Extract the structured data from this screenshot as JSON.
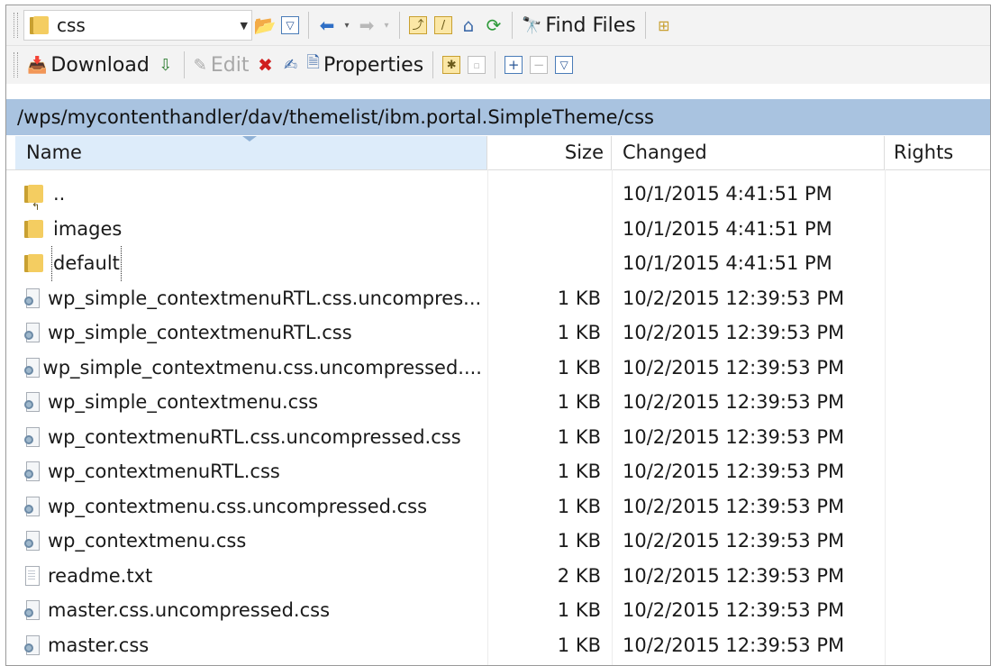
{
  "toolbar1": {
    "path_combo_value": "css",
    "find_files_label": "Find Files"
  },
  "toolbar2": {
    "download_label": "Download",
    "edit_label": "Edit",
    "properties_label": "Properties"
  },
  "path": "/wps/mycontenthandler/dav/themelist/ibm.portal.SimpleTheme/css",
  "columns": {
    "name": "Name",
    "size": "Size",
    "changed": "Changed",
    "rights": "Rights"
  },
  "files": [
    {
      "name": "..",
      "size": "",
      "changed": "10/1/2015 4:41:51 PM",
      "type": "parent"
    },
    {
      "name": "images",
      "size": "",
      "changed": "10/1/2015 4:41:51 PM",
      "type": "folder"
    },
    {
      "name": "default",
      "size": "",
      "changed": "10/1/2015 4:41:51 PM",
      "type": "folder"
    },
    {
      "name": "wp_simple_contextmenuRTL.css.uncompres...",
      "size": "1 KB",
      "changed": "10/2/2015 12:39:53 PM",
      "type": "css"
    },
    {
      "name": "wp_simple_contextmenuRTL.css",
      "size": "1 KB",
      "changed": "10/2/2015 12:39:53 PM",
      "type": "css"
    },
    {
      "name": "wp_simple_contextmenu.css.uncompressed....",
      "size": "1 KB",
      "changed": "10/2/2015 12:39:53 PM",
      "type": "css"
    },
    {
      "name": "wp_simple_contextmenu.css",
      "size": "1 KB",
      "changed": "10/2/2015 12:39:53 PM",
      "type": "css"
    },
    {
      "name": "wp_contextmenuRTL.css.uncompressed.css",
      "size": "1 KB",
      "changed": "10/2/2015 12:39:53 PM",
      "type": "css"
    },
    {
      "name": "wp_contextmenuRTL.css",
      "size": "1 KB",
      "changed": "10/2/2015 12:39:53 PM",
      "type": "css"
    },
    {
      "name": "wp_contextmenu.css.uncompressed.css",
      "size": "1 KB",
      "changed": "10/2/2015 12:39:53 PM",
      "type": "css"
    },
    {
      "name": "wp_contextmenu.css",
      "size": "1 KB",
      "changed": "10/2/2015 12:39:53 PM",
      "type": "css"
    },
    {
      "name": "readme.txt",
      "size": "2 KB",
      "changed": "10/2/2015 12:39:53 PM",
      "type": "txt"
    },
    {
      "name": "master.css.uncompressed.css",
      "size": "1 KB",
      "changed": "10/2/2015 12:39:53 PM",
      "type": "css"
    },
    {
      "name": "master.css",
      "size": "1 KB",
      "changed": "10/2/2015 12:39:53 PM",
      "type": "css"
    }
  ],
  "colors": {
    "path_bar_bg": "#a9c3e0",
    "header_selected_bg": "#ddecfa",
    "folder": "#f4cd61"
  }
}
